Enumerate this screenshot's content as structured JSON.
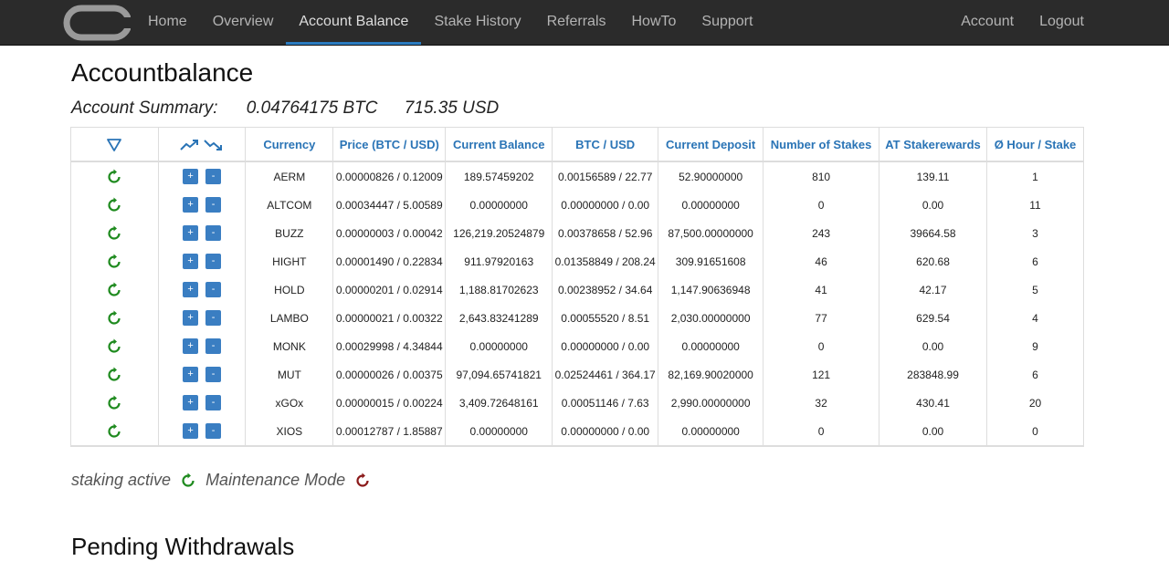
{
  "nav": {
    "left": [
      "Home",
      "Overview",
      "Account Balance",
      "Stake History",
      "Referrals",
      "HowTo",
      "Support"
    ],
    "active_index": 2,
    "right": [
      "Account",
      "Logout"
    ]
  },
  "page_title": "Accountbalance",
  "summary": {
    "label": "Account Summary:",
    "btc": "0.04764175 BTC",
    "usd": "715.35 USD"
  },
  "table": {
    "headers": [
      "Currency",
      "Price (BTC / USD)",
      "Current Balance",
      "BTC / USD",
      "Current Deposit",
      "Number of Stakes",
      "AT Stakerewards",
      "Ø Hour / Stake"
    ],
    "icons": {
      "filter": "filter-triangle-icon",
      "trend_up": "trend-up-icon",
      "trend_down": "trend-down-icon",
      "staking": "refresh-icon"
    },
    "plus_label": "+",
    "minus_label": "-",
    "rows": [
      {
        "currency": "AERM",
        "price": "0.00000826 / 0.12009",
        "balance": "189.57459202",
        "btc_usd": "0.00156589 / 22.77",
        "deposit": "52.90000000",
        "stakes": "810",
        "rewards": "139.11",
        "hour_stake": "1"
      },
      {
        "currency": "ALTCOM",
        "price": "0.00034447 / 5.00589",
        "balance": "0.00000000",
        "btc_usd": "0.00000000 / 0.00",
        "deposit": "0.00000000",
        "stakes": "0",
        "rewards": "0.00",
        "hour_stake": "11"
      },
      {
        "currency": "BUZZ",
        "price": "0.00000003 / 0.00042",
        "balance": "126,219.20524879",
        "btc_usd": "0.00378658 / 52.96",
        "deposit": "87,500.00000000",
        "stakes": "243",
        "rewards": "39664.58",
        "hour_stake": "3"
      },
      {
        "currency": "HIGHT",
        "price": "0.00001490 / 0.22834",
        "balance": "911.97920163",
        "btc_usd": "0.01358849 / 208.24",
        "deposit": "309.91651608",
        "stakes": "46",
        "rewards": "620.68",
        "hour_stake": "6"
      },
      {
        "currency": "HOLD",
        "price": "0.00000201 / 0.02914",
        "balance": "1,188.81702623",
        "btc_usd": "0.00238952 / 34.64",
        "deposit": "1,147.90636948",
        "stakes": "41",
        "rewards": "42.17",
        "hour_stake": "5"
      },
      {
        "currency": "LAMBO",
        "price": "0.00000021 / 0.00322",
        "balance": "2,643.83241289",
        "btc_usd": "0.00055520 / 8.51",
        "deposit": "2,030.00000000",
        "stakes": "77",
        "rewards": "629.54",
        "hour_stake": "4"
      },
      {
        "currency": "MONK",
        "price": "0.00029998 / 4.34844",
        "balance": "0.00000000",
        "btc_usd": "0.00000000 / 0.00",
        "deposit": "0.00000000",
        "stakes": "0",
        "rewards": "0.00",
        "hour_stake": "9"
      },
      {
        "currency": "MUT",
        "price": "0.00000026 / 0.00375",
        "balance": "97,094.65741821",
        "btc_usd": "0.02524461 / 364.17",
        "deposit": "82,169.90020000",
        "stakes": "121",
        "rewards": "283848.99",
        "hour_stake": "6"
      },
      {
        "currency": "xGOx",
        "price": "0.00000015 / 0.00224",
        "balance": "3,409.72648161",
        "btc_usd": "0.00051146 / 7.63",
        "deposit": "2,990.00000000",
        "stakes": "32",
        "rewards": "430.41",
        "hour_stake": "20"
      },
      {
        "currency": "XIOS",
        "price": "0.00012787 / 1.85887",
        "balance": "0.00000000",
        "btc_usd": "0.00000000 / 0.00",
        "deposit": "0.00000000",
        "stakes": "0",
        "rewards": "0.00",
        "hour_stake": "0"
      }
    ]
  },
  "legend": {
    "active_label": "staking active",
    "maintenance_label": "Maintenance Mode",
    "active_color": "#1e8a1e",
    "maintenance_color": "#8b1a1a"
  },
  "next_section_title": "Pending Withdrawals"
}
